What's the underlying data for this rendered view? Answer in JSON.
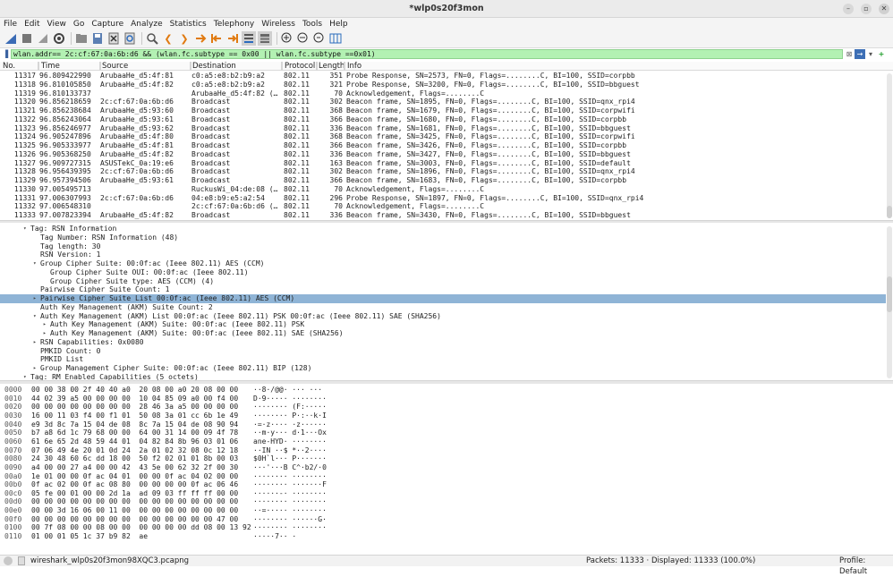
{
  "window": {
    "title": "*wlp0s20f3mon"
  },
  "menu": [
    "File",
    "Edit",
    "View",
    "Go",
    "Capture",
    "Analyze",
    "Statistics",
    "Telephony",
    "Wireless",
    "Tools",
    "Help"
  ],
  "filter": {
    "value": "wlan.addr== 2c:cf:67:0a:6b:d6 && (wlan.fc.subtype == 0x00 || wlan.fc.subtype ==0x01)"
  },
  "columns": [
    "No.",
    "Time",
    "Source",
    "Destination",
    "Protocol",
    "Length",
    "Info"
  ],
  "packets": [
    {
      "no": "11317",
      "time": "96.809422990",
      "src": "ArubaaHe_d5:4f:81",
      "dst": "c0:a5:e8:b2:b9:a2",
      "proto": "802.11",
      "len": "351",
      "info": "Probe Response, SN=2573, FN=0, Flags=........C, BI=100, SSID=corpbb"
    },
    {
      "no": "11318",
      "time": "96.810105850",
      "src": "ArubaaHe_d5:4f:82",
      "dst": "c0:a5:e8:b2:b9:a2",
      "proto": "802.11",
      "len": "321",
      "info": "Probe Response, SN=3200, FN=0, Flags=........C, BI=100, SSID=bbguest"
    },
    {
      "no": "11319",
      "time": "96.810133737",
      "src": "",
      "dst": "ArubaaHe_d5:4f:82 (…",
      "proto": "802.11",
      "len": "70",
      "info": "Acknowledgement, Flags=........C"
    },
    {
      "no": "11320",
      "time": "96.856218659",
      "src": "2c:cf:67:0a:6b:d6",
      "dst": "Broadcast",
      "proto": "802.11",
      "len": "302",
      "info": "Beacon frame, SN=1895, FN=0, Flags=........C, BI=100, SSID=qnx_rpi4"
    },
    {
      "no": "11321",
      "time": "96.856238684",
      "src": "ArubaaHe_d5:93:60",
      "dst": "Broadcast",
      "proto": "802.11",
      "len": "368",
      "info": "Beacon frame, SN=1679, FN=0, Flags=........C, BI=100, SSID=corpwifi"
    },
    {
      "no": "11322",
      "time": "96.856243064",
      "src": "ArubaaHe_d5:93:61",
      "dst": "Broadcast",
      "proto": "802.11",
      "len": "366",
      "info": "Beacon frame, SN=1680, FN=0, Flags=........C, BI=100, SSID=corpbb"
    },
    {
      "no": "11323",
      "time": "96.856246977",
      "src": "ArubaaHe_d5:93:62",
      "dst": "Broadcast",
      "proto": "802.11",
      "len": "336",
      "info": "Beacon frame, SN=1681, FN=0, Flags=........C, BI=100, SSID=bbguest"
    },
    {
      "no": "11324",
      "time": "96.905247896",
      "src": "ArubaaHe_d5:4f:80",
      "dst": "Broadcast",
      "proto": "802.11",
      "len": "368",
      "info": "Beacon frame, SN=3425, FN=0, Flags=........C, BI=100, SSID=corpwifi"
    },
    {
      "no": "11325",
      "time": "96.905333977",
      "src": "ArubaaHe_d5:4f:81",
      "dst": "Broadcast",
      "proto": "802.11",
      "len": "366",
      "info": "Beacon frame, SN=3426, FN=0, Flags=........C, BI=100, SSID=corpbb"
    },
    {
      "no": "11326",
      "time": "96.905368250",
      "src": "ArubaaHe_d5:4f:82",
      "dst": "Broadcast",
      "proto": "802.11",
      "len": "336",
      "info": "Beacon frame, SN=3427, FN=0, Flags=........C, BI=100, SSID=bbguest"
    },
    {
      "no": "11327",
      "time": "96.909727315",
      "src": "ASUSTekC_0a:19:e6",
      "dst": "Broadcast",
      "proto": "802.11",
      "len": "163",
      "info": "Beacon frame, SN=3003, FN=0, Flags=........C, BI=100, SSID=default"
    },
    {
      "no": "11328",
      "time": "96.956439395",
      "src": "2c:cf:67:0a:6b:d6",
      "dst": "Broadcast",
      "proto": "802.11",
      "len": "302",
      "info": "Beacon frame, SN=1896, FN=0, Flags=........C, BI=100, SSID=qnx_rpi4"
    },
    {
      "no": "11329",
      "time": "96.957394506",
      "src": "ArubaaHe_d5:93:61",
      "dst": "Broadcast",
      "proto": "802.11",
      "len": "366",
      "info": "Beacon frame, SN=1683, FN=0, Flags=........C, BI=100, SSID=corpbb"
    },
    {
      "no": "11330",
      "time": "97.005495713",
      "src": "",
      "dst": "RuckusWi_04:de:08 (…",
      "proto": "802.11",
      "len": "70",
      "info": "Acknowledgement, Flags=........C"
    },
    {
      "no": "11331",
      "time": "97.006307993",
      "src": "2c:cf:67:0a:6b:d6",
      "dst": "04:e8:b9:e5:a2:54",
      "proto": "802.11",
      "len": "296",
      "info": "Probe Response, SN=1897, FN=0, Flags=........C, BI=100, SSID=qnx_rpi4"
    },
    {
      "no": "11332",
      "time": "97.006548310",
      "src": "",
      "dst": "2c:cf:67:0a:6b:d6 (…",
      "proto": "802.11",
      "len": "70",
      "info": "Acknowledgement, Flags=........C"
    },
    {
      "no": "11333",
      "time": "97.007823394",
      "src": "ArubaaHe_d5:4f:82",
      "dst": "Broadcast",
      "proto": "802.11",
      "len": "336",
      "info": "Beacon frame, SN=3430, FN=0, Flags=........C, BI=100, SSID=bbguest"
    }
  ],
  "details": [
    {
      "arrow": "▾",
      "indent": 1,
      "text": "Tag: RSN Information"
    },
    {
      "arrow": "",
      "indent": 2,
      "text": "Tag Number: RSN Information (48)"
    },
    {
      "arrow": "",
      "indent": 2,
      "text": "Tag length: 30"
    },
    {
      "arrow": "",
      "indent": 2,
      "text": "RSN Version: 1"
    },
    {
      "arrow": "▾",
      "indent": 2,
      "text": "Group Cipher Suite: 00:0f:ac (Ieee 802.11) AES (CCM)"
    },
    {
      "arrow": "",
      "indent": 3,
      "text": "Group Cipher Suite OUI: 00:0f:ac (Ieee 802.11)"
    },
    {
      "arrow": "",
      "indent": 3,
      "text": "Group Cipher Suite type: AES (CCM) (4)"
    },
    {
      "arrow": "",
      "indent": 2,
      "text": "Pairwise Cipher Suite Count: 1"
    },
    {
      "arrow": "▸",
      "indent": 2,
      "text": "Pairwise Cipher Suite List 00:0f:ac (Ieee 802.11) AES (CCM)",
      "selected": true
    },
    {
      "arrow": "",
      "indent": 2,
      "text": "Auth Key Management (AKM) Suite Count: 2"
    },
    {
      "arrow": "▾",
      "indent": 2,
      "text": "Auth Key Management (AKM) List 00:0f:ac (Ieee 802.11) PSK 00:0f:ac (Ieee 802.11) SAE (SHA256)"
    },
    {
      "arrow": "▸",
      "indent": 3,
      "text": "Auth Key Management (AKM) Suite: 00:0f:ac (Ieee 802.11) PSK"
    },
    {
      "arrow": "▸",
      "indent": 3,
      "text": "Auth Key Management (AKM) Suite: 00:0f:ac (Ieee 802.11) SAE (SHA256)"
    },
    {
      "arrow": "▸",
      "indent": 2,
      "text": "RSN Capabilities: 0x0080"
    },
    {
      "arrow": "",
      "indent": 2,
      "text": "PMKID Count: 0"
    },
    {
      "arrow": "",
      "indent": 2,
      "text": "PMKID List"
    },
    {
      "arrow": "▸",
      "indent": 2,
      "text": "Group Management Cipher Suite: 00:0f:ac (Ieee 802.11) BIP (128)"
    },
    {
      "arrow": "▾",
      "indent": 1,
      "text": "Tag: RM Enabled Capabilities (5 octets)"
    }
  ],
  "bytes": [
    {
      "off": "0000",
      "hex": "00 00 38 00 2f 40 40 a0  20 08 00 a0 20 08 00 00",
      "asc": "··8·/@@· ··· ···"
    },
    {
      "off": "0010",
      "hex": "44 02 39 a5 00 00 00 00  10 04 85 09 a0 00 f4 00",
      "asc": "D·9····· ········"
    },
    {
      "off": "0020",
      "hex": "00 00 00 00 00 00 00 00  28 46 3a a5 00 00 00 00",
      "asc": "········ (F:·····"
    },
    {
      "off": "0030",
      "hex": "16 00 11 03 f4 00 f1 01  50 08 3a 01 cc 6b 1e 49",
      "asc": "········ P·:··k·I"
    },
    {
      "off": "0040",
      "hex": "e9 3d 8c 7a 15 04 de 08  8c 7a 15 04 de 08 90 94",
      "asc": "·=·z···· ·z······"
    },
    {
      "off": "0050",
      "hex": "b7 a8 6d 1c 79 68 00 00  64 00 31 14 00 09 4f 78",
      "asc": "··m·y··· d·1···Ox"
    },
    {
      "off": "0060",
      "hex": "61 6e 65 2d 48 59 44 01  04 82 84 8b 96 03 01 06",
      "asc": "ane-HYD· ········"
    },
    {
      "off": "0070",
      "hex": "07 06 49 4e 20 01 0d 24  2a 01 02 32 08 0c 12 18",
      "asc": "··IN ··$ *··2····"
    },
    {
      "off": "0080",
      "hex": "24 30 48 60 6c dd 18 00  50 f2 02 01 01 8b 00 03",
      "asc": "$0H`l··· P·······"
    },
    {
      "off": "0090",
      "hex": "a4 00 00 27 a4 00 00 42  43 5e 00 62 32 2f 00 30",
      "asc": "···'···B C^·b2/·0"
    },
    {
      "off": "00a0",
      "hex": "1e 01 00 00 0f ac 04 01  00 00 0f ac 04 02 00 00",
      "asc": "········ ········"
    },
    {
      "off": "00b0",
      "hex": "0f ac 02 00 0f ac 08 80  00 00 00 00 0f ac 06 46",
      "asc": "········ ·······F"
    },
    {
      "off": "00c0",
      "hex": "05 fe 00 01 00 00 2d 1a  ad 09 03 ff ff ff 00 00",
      "asc": "······-· ········"
    },
    {
      "off": "00d0",
      "hex": "00 00 00 00 00 00 00 00  00 00 00 00 00 00 00 00",
      "asc": "········ ········"
    },
    {
      "off": "00e0",
      "hex": "00 00 3d 16 06 00 11 00  00 00 00 00 00 00 00 00",
      "asc": "··=····· ········"
    },
    {
      "off": "00f0",
      "hex": "00 00 00 00 00 00 00 00  00 00 00 00 00 00 47 00",
      "asc": "········ ······G·"
    },
    {
      "off": "0100",
      "hex": "00 7f 08 00 00 08 00 00  00 00 00 00 dd 08 00 13 92",
      "asc": "········ ········"
    },
    {
      "off": "0110",
      "hex": "01 00 01 05 1c 37 b9 82  ae",
      "asc": "·····7·· ·"
    }
  ],
  "status": {
    "file": "wireshark_wlp0s20f3mon98XQC3.pcapng",
    "packets": "Packets: 11333 · Displayed: 11333 (100.0%)",
    "profile": "Profile: Default"
  },
  "colors": {
    "selected": "#8fb4d6",
    "filter_ok": "#b3f1b3",
    "beacon_row": "#ffffff"
  }
}
